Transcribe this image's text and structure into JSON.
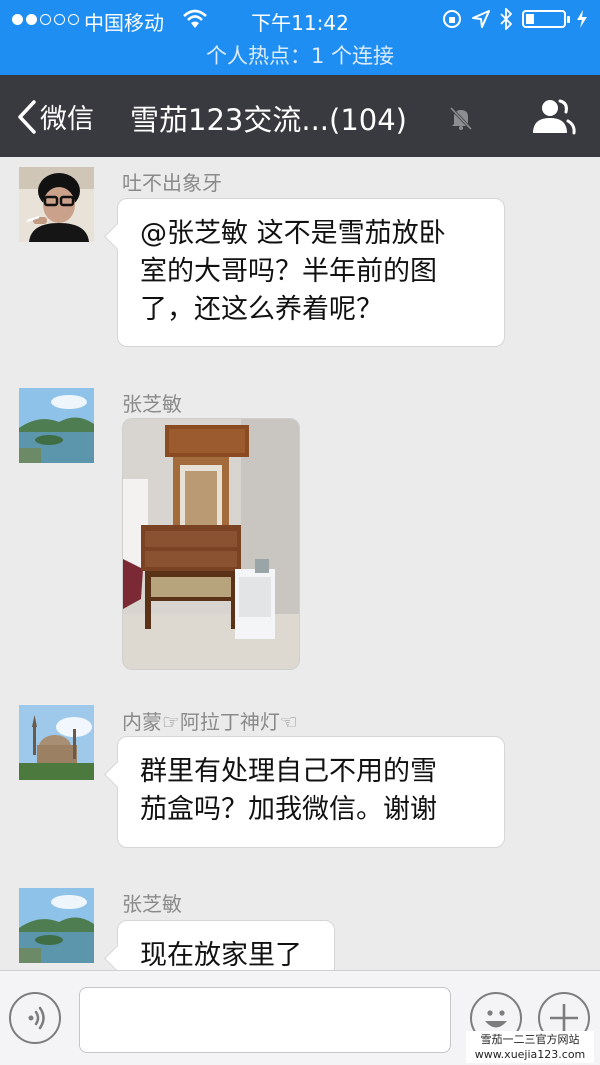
{
  "status_bar": {
    "carrier": "中国移动",
    "time": "下午11:42",
    "hotspot": "个人热点：1 个连接"
  },
  "nav": {
    "back_label": "微信",
    "title": "雪茄123交流...(104)"
  },
  "messages": [
    {
      "sender": "吐不出象牙",
      "text_lines": [
        "@张芝敏 这不是雪茄放卧",
        "室的大哥吗？半年前的图",
        "了，还这么养着呢？"
      ]
    },
    {
      "sender": "张芝敏",
      "type": "image"
    },
    {
      "sender": "内蒙☞阿拉丁神灯☜",
      "text_lines": [
        "群里有处理自己不用的雪",
        "茄盒吗？加我微信。谢谢"
      ]
    },
    {
      "sender": "张芝敏",
      "text_lines": [
        "现在放家里了"
      ]
    }
  ],
  "input_bar": {
    "placeholder": ""
  },
  "watermark": {
    "line1": "雪茄一二三官方网站",
    "line2": "www.xuejia123.com"
  },
  "colors": {
    "status_blue": "#1f8ef2",
    "nav_dark": "#393a3f",
    "chat_bg": "#ebebeb"
  }
}
